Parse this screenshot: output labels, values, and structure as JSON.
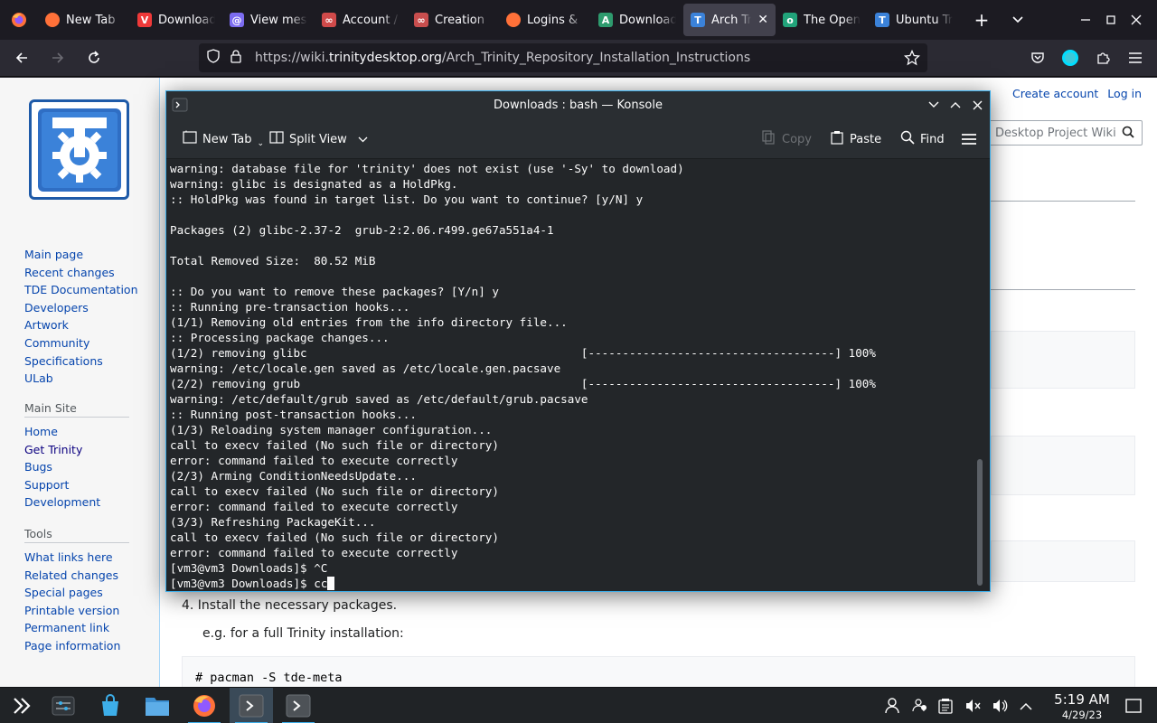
{
  "browser": {
    "tabs": [
      {
        "title": "New Tab",
        "favicon": "firefox-icon",
        "active": false
      },
      {
        "title": "Downloads",
        "favicon": "vivaldi-icon",
        "active": false
      },
      {
        "title": "View message",
        "favicon": "email-icon",
        "active": false
      },
      {
        "title": "Account / ",
        "favicon": "account-icon",
        "active": false
      },
      {
        "title": "Creation ",
        "favicon": "link-icon",
        "active": false
      },
      {
        "title": "Logins & ",
        "favicon": "firefox-icon",
        "active": false
      },
      {
        "title": "Download",
        "favicon": "download-icon",
        "active": false
      },
      {
        "title": "Arch Trinity",
        "favicon": "trinity-icon",
        "active": true
      },
      {
        "title": "The Open",
        "favicon": "opensuse-icon",
        "active": false
      },
      {
        "title": "Ubuntu Trinity",
        "favicon": "trinity-icon",
        "active": false
      }
    ],
    "url_scheme_host_prefix": "https://wiki.",
    "url_host": "trinitydesktop.org",
    "url_path": "/Arch_Trinity_Repository_Installation_Instructions"
  },
  "wiki": {
    "personal": [
      "Create account",
      "Log in"
    ],
    "search_placeholder": "Desktop Project Wiki",
    "nav_main": [
      "Main page",
      "Recent changes",
      "TDE Documentation",
      "Developers",
      "Artwork",
      "Community",
      "Specifications",
      "ULab"
    ],
    "main_site_heading": "Main Site",
    "nav_main_site": [
      "Home",
      "Get Trinity",
      "Bugs",
      "Support",
      "Development"
    ],
    "tools_heading": "Tools",
    "nav_tools": [
      "What links here",
      "Related changes",
      "Special pages",
      "Printable version",
      "Permanent link",
      "Page information"
    ],
    "step4": "4. Install the necessary packages.",
    "example": "e.g. for a full Trinity installation:",
    "code_line": "# pacman -S tde-meta"
  },
  "konsole": {
    "title": "Downloads : bash — Konsole",
    "toolbar": {
      "new_tab": "New Tab",
      "split_view": "Split View",
      "copy": "Copy",
      "paste": "Paste",
      "find": "Find"
    },
    "lines": [
      "warning: database file for 'trinity' does not exist (use '-Sy' to download)",
      "warning: glibc is designated as a HoldPkg.",
      ":: HoldPkg was found in target list. Do you want to continue? [y/N] y",
      "",
      "Packages (2) glibc-2.37-2  grub-2:2.06.r499.ge67a551a4-1",
      "",
      "Total Removed Size:  80.52 MiB",
      "",
      ":: Do you want to remove these packages? [Y/n] y",
      ":: Running pre-transaction hooks...",
      "(1/1) Removing old entries from the info directory file...",
      ":: Processing package changes...",
      "(1/2) removing glibc                                        [------------------------------------] 100%",
      "warning: /etc/locale.gen saved as /etc/locale.gen.pacsave",
      "(2/2) removing grub                                         [------------------------------------] 100%",
      "warning: /etc/default/grub saved as /etc/default/grub.pacsave",
      ":: Running post-transaction hooks...",
      "(1/3) Reloading system manager configuration...",
      "call to execv failed (No such file or directory)",
      "error: command failed to execute correctly",
      "(2/3) Arming ConditionNeedsUpdate...",
      "call to execv failed (No such file or directory)",
      "error: command failed to execute correctly",
      "(3/3) Refreshing PackageKit...",
      "call to execv failed (No such file or directory)",
      "error: command failed to execute correctly",
      "[vm3@vm3 Downloads]$ ^C"
    ],
    "prompt_line": "[vm3@vm3 Downloads]$ cc"
  },
  "taskbar": {
    "clock_time": "5:19 AM",
    "clock_date": "4/29/23"
  },
  "colors": {
    "accent": "#3daee9",
    "terminal_bg": "#232629",
    "wiki_link": "#0645ad"
  }
}
